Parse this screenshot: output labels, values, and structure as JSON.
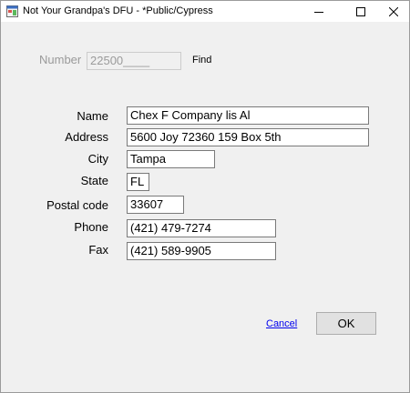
{
  "window": {
    "title": "Not Your Grandpa's DFU - *Public/Cypress"
  },
  "lookup": {
    "number_label": "Number",
    "number_value": "22500____",
    "find_label": "Find"
  },
  "form": {
    "name_label": "Name",
    "name_value": "Chex F Company lis Al",
    "address_label": "Address",
    "address_value": "5600 Joy 72360 159 Box 5th",
    "city_label": "City",
    "city_value": "Tampa",
    "state_label": "State",
    "state_value": "FL",
    "postal_label": "Postal code",
    "postal_value": "33607",
    "phone_label": "Phone",
    "phone_value": "(421) 479-7274",
    "fax_label": "Fax",
    "fax_value": "(421) 589-9905"
  },
  "actions": {
    "cancel_label": "Cancel",
    "ok_label": "OK"
  }
}
